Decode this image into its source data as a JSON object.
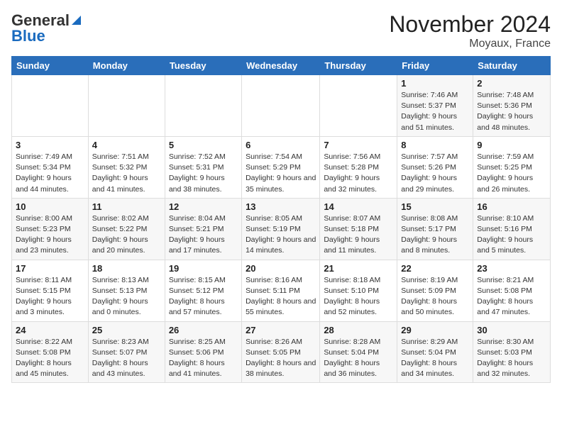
{
  "logo": {
    "line1": "General",
    "line2": "Blue"
  },
  "title": "November 2024",
  "location": "Moyaux, France",
  "days_of_week": [
    "Sunday",
    "Monday",
    "Tuesday",
    "Wednesday",
    "Thursday",
    "Friday",
    "Saturday"
  ],
  "weeks": [
    [
      {
        "day": "",
        "info": ""
      },
      {
        "day": "",
        "info": ""
      },
      {
        "day": "",
        "info": ""
      },
      {
        "day": "",
        "info": ""
      },
      {
        "day": "",
        "info": ""
      },
      {
        "day": "1",
        "info": "Sunrise: 7:46 AM\nSunset: 5:37 PM\nDaylight: 9 hours and 51 minutes."
      },
      {
        "day": "2",
        "info": "Sunrise: 7:48 AM\nSunset: 5:36 PM\nDaylight: 9 hours and 48 minutes."
      }
    ],
    [
      {
        "day": "3",
        "info": "Sunrise: 7:49 AM\nSunset: 5:34 PM\nDaylight: 9 hours and 44 minutes."
      },
      {
        "day": "4",
        "info": "Sunrise: 7:51 AM\nSunset: 5:32 PM\nDaylight: 9 hours and 41 minutes."
      },
      {
        "day": "5",
        "info": "Sunrise: 7:52 AM\nSunset: 5:31 PM\nDaylight: 9 hours and 38 minutes."
      },
      {
        "day": "6",
        "info": "Sunrise: 7:54 AM\nSunset: 5:29 PM\nDaylight: 9 hours and 35 minutes."
      },
      {
        "day": "7",
        "info": "Sunrise: 7:56 AM\nSunset: 5:28 PM\nDaylight: 9 hours and 32 minutes."
      },
      {
        "day": "8",
        "info": "Sunrise: 7:57 AM\nSunset: 5:26 PM\nDaylight: 9 hours and 29 minutes."
      },
      {
        "day": "9",
        "info": "Sunrise: 7:59 AM\nSunset: 5:25 PM\nDaylight: 9 hours and 26 minutes."
      }
    ],
    [
      {
        "day": "10",
        "info": "Sunrise: 8:00 AM\nSunset: 5:23 PM\nDaylight: 9 hours and 23 minutes."
      },
      {
        "day": "11",
        "info": "Sunrise: 8:02 AM\nSunset: 5:22 PM\nDaylight: 9 hours and 20 minutes."
      },
      {
        "day": "12",
        "info": "Sunrise: 8:04 AM\nSunset: 5:21 PM\nDaylight: 9 hours and 17 minutes."
      },
      {
        "day": "13",
        "info": "Sunrise: 8:05 AM\nSunset: 5:19 PM\nDaylight: 9 hours and 14 minutes."
      },
      {
        "day": "14",
        "info": "Sunrise: 8:07 AM\nSunset: 5:18 PM\nDaylight: 9 hours and 11 minutes."
      },
      {
        "day": "15",
        "info": "Sunrise: 8:08 AM\nSunset: 5:17 PM\nDaylight: 9 hours and 8 minutes."
      },
      {
        "day": "16",
        "info": "Sunrise: 8:10 AM\nSunset: 5:16 PM\nDaylight: 9 hours and 5 minutes."
      }
    ],
    [
      {
        "day": "17",
        "info": "Sunrise: 8:11 AM\nSunset: 5:15 PM\nDaylight: 9 hours and 3 minutes."
      },
      {
        "day": "18",
        "info": "Sunrise: 8:13 AM\nSunset: 5:13 PM\nDaylight: 9 hours and 0 minutes."
      },
      {
        "day": "19",
        "info": "Sunrise: 8:15 AM\nSunset: 5:12 PM\nDaylight: 8 hours and 57 minutes."
      },
      {
        "day": "20",
        "info": "Sunrise: 8:16 AM\nSunset: 5:11 PM\nDaylight: 8 hours and 55 minutes."
      },
      {
        "day": "21",
        "info": "Sunrise: 8:18 AM\nSunset: 5:10 PM\nDaylight: 8 hours and 52 minutes."
      },
      {
        "day": "22",
        "info": "Sunrise: 8:19 AM\nSunset: 5:09 PM\nDaylight: 8 hours and 50 minutes."
      },
      {
        "day": "23",
        "info": "Sunrise: 8:21 AM\nSunset: 5:08 PM\nDaylight: 8 hours and 47 minutes."
      }
    ],
    [
      {
        "day": "24",
        "info": "Sunrise: 8:22 AM\nSunset: 5:08 PM\nDaylight: 8 hours and 45 minutes."
      },
      {
        "day": "25",
        "info": "Sunrise: 8:23 AM\nSunset: 5:07 PM\nDaylight: 8 hours and 43 minutes."
      },
      {
        "day": "26",
        "info": "Sunrise: 8:25 AM\nSunset: 5:06 PM\nDaylight: 8 hours and 41 minutes."
      },
      {
        "day": "27",
        "info": "Sunrise: 8:26 AM\nSunset: 5:05 PM\nDaylight: 8 hours and 38 minutes."
      },
      {
        "day": "28",
        "info": "Sunrise: 8:28 AM\nSunset: 5:04 PM\nDaylight: 8 hours and 36 minutes."
      },
      {
        "day": "29",
        "info": "Sunrise: 8:29 AM\nSunset: 5:04 PM\nDaylight: 8 hours and 34 minutes."
      },
      {
        "day": "30",
        "info": "Sunrise: 8:30 AM\nSunset: 5:03 PM\nDaylight: 8 hours and 32 minutes."
      }
    ]
  ]
}
